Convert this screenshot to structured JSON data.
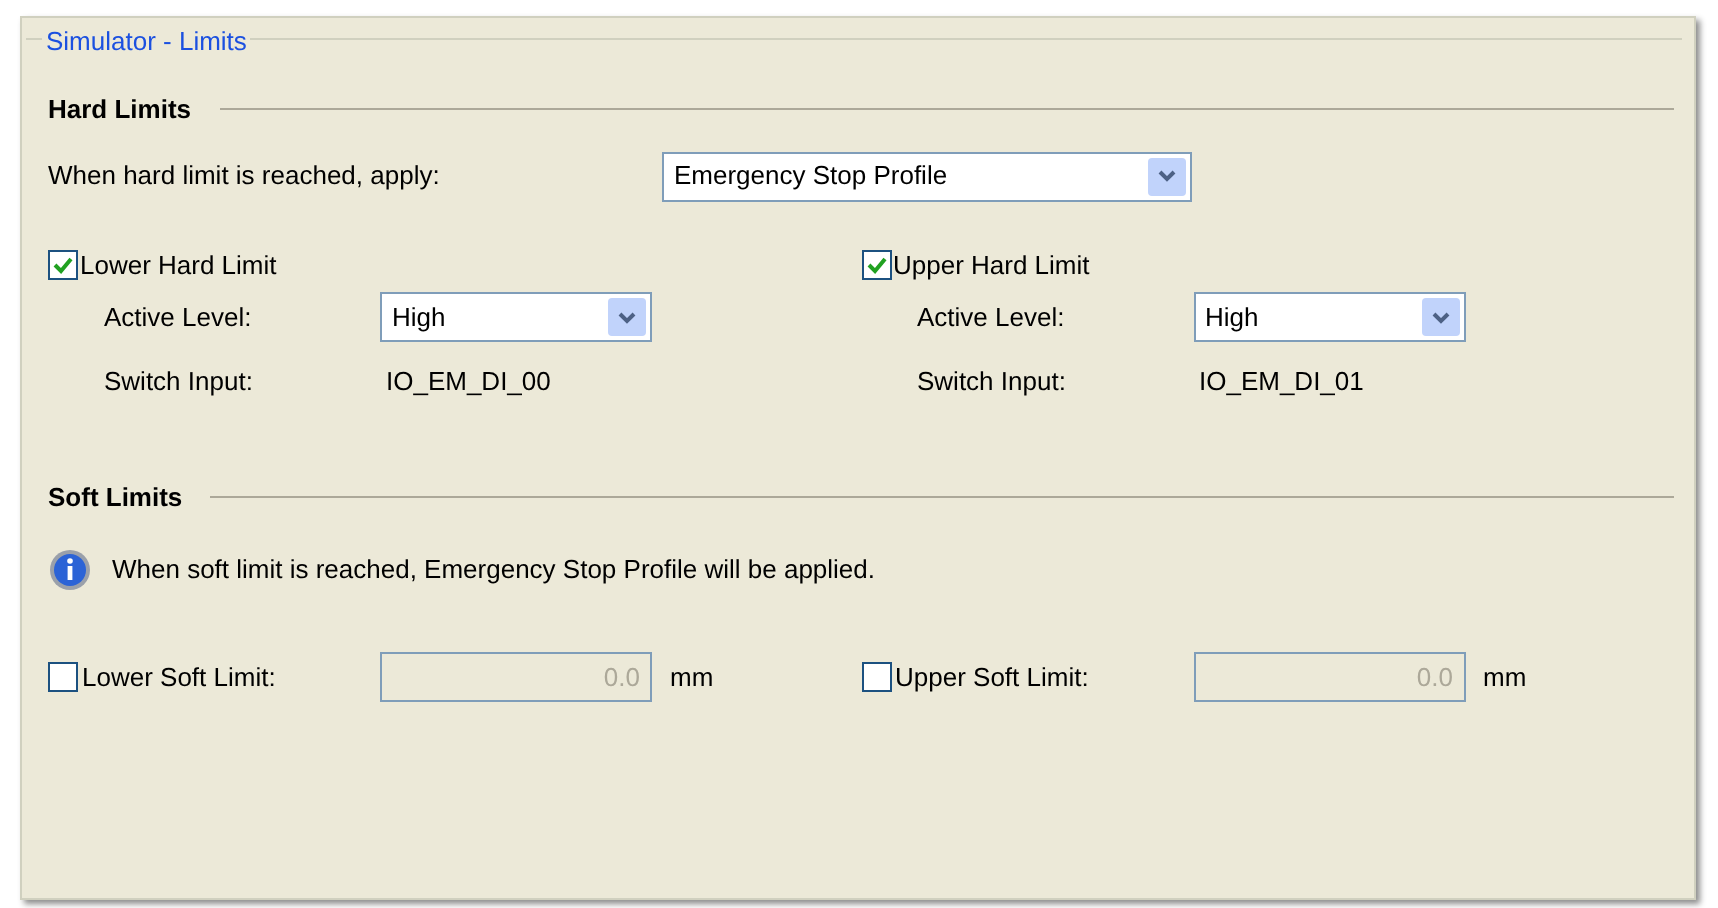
{
  "panel": {
    "title": "Simulator - Limits"
  },
  "hard_limits": {
    "heading": "Hard Limits",
    "apply_label": "When hard limit is reached, apply:",
    "apply_value": "Emergency Stop Profile",
    "limits": [
      {
        "label": "Lower Hard Limit",
        "checked": true,
        "active_level_label": "Active Level:",
        "active_level_value": "High",
        "switch_input_label": "Switch Input:",
        "switch_input_value": "IO_EM_DI_00"
      },
      {
        "label": "Upper Hard Limit",
        "checked": true,
        "active_level_label": "Active Level:",
        "active_level_value": "High",
        "switch_input_label": "Switch Input:",
        "switch_input_value": "IO_EM_DI_01"
      }
    ]
  },
  "soft_limits": {
    "heading": "Soft Limits",
    "info": "When soft limit is reached, Emergency Stop Profile will be applied.",
    "limits": [
      {
        "label": "Lower Soft Limit:",
        "checked": false,
        "value": "0.0",
        "disabled": true,
        "unit": "mm"
      },
      {
        "label": "Upper Soft Limit:",
        "checked": false,
        "value": "0.0",
        "disabled": true,
        "unit": "mm"
      }
    ]
  }
}
